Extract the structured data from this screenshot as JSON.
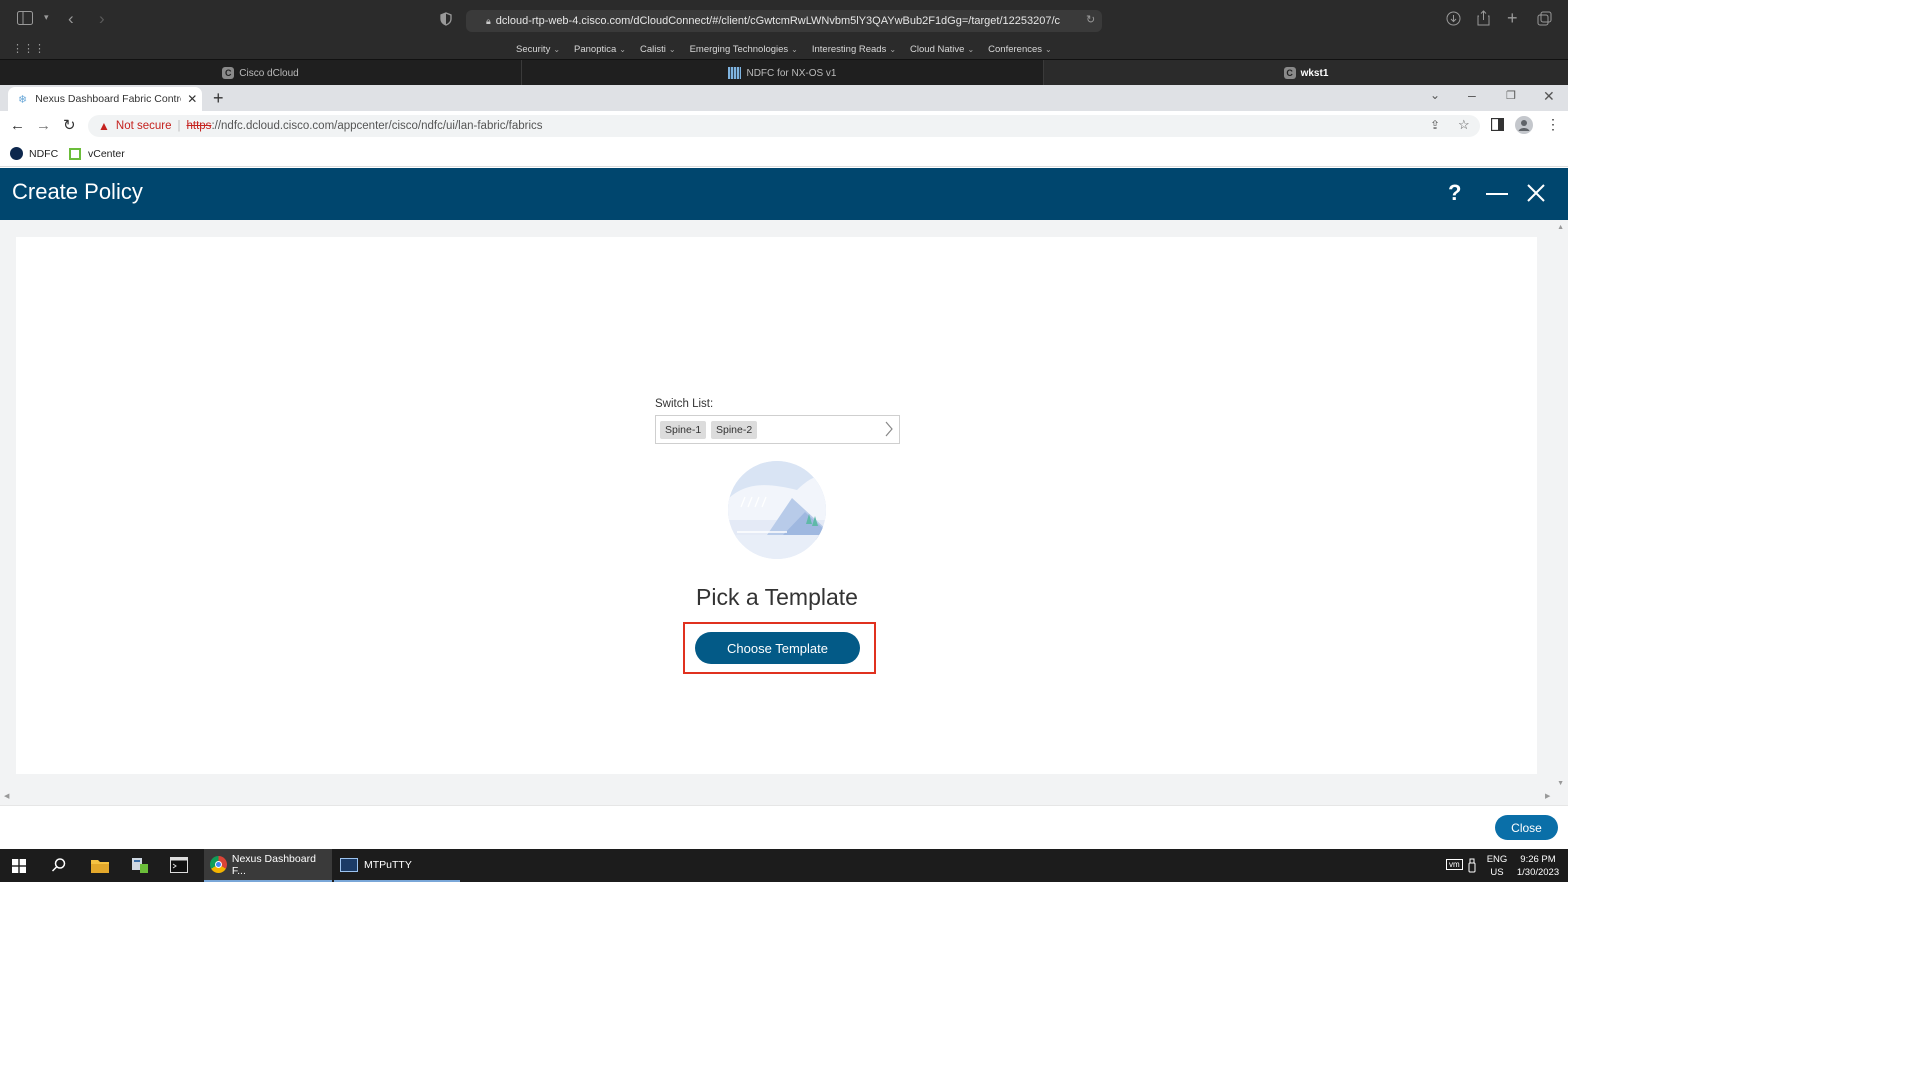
{
  "safari": {
    "url": "dcloud-rtp-web-4.cisco.com/dCloudConnect/#/client/cGwtcmRwLWNvbm5lY3QAYwBub2F1dGg=/target/12253207/c",
    "bookmarks": [
      "Security",
      "Panoptica",
      "Calisti",
      "Emerging Technologies",
      "Interesting Reads",
      "Cloud Native",
      "Conferences"
    ],
    "tabs": [
      {
        "label": "Cisco dCloud",
        "favicon": "C"
      },
      {
        "label": "NDFC for NX-OS v1",
        "favicon": ""
      },
      {
        "label": "wkst1",
        "favicon": "C"
      }
    ]
  },
  "chrome": {
    "tab_title": "Nexus Dashboard Fabric Controll",
    "security_label": "Not secure",
    "url_scheme": "https",
    "url_rest": "://ndfc.dcloud.cisco.com/appcenter/cisco/ndfc/ui/lan-fabric/fabrics",
    "bookmarks": [
      {
        "label": "NDFC"
      },
      {
        "label": "vCenter"
      }
    ]
  },
  "app": {
    "title": "Create Policy",
    "help_glyph": "?",
    "switch_list_label": "Switch List:",
    "switches": [
      "Spine-1",
      "Spine-2"
    ],
    "empty_title": "Pick a Template",
    "choose_button": "Choose Template",
    "close_button": "Close"
  },
  "taskbar": {
    "apps": [
      {
        "label": "Nexus Dashboard F..."
      },
      {
        "label": "MTPuTTY"
      }
    ],
    "lang_top": "ENG",
    "lang_bottom": "US",
    "time": "9:26 PM",
    "date": "1/30/2023",
    "vm_label": "vm"
  }
}
